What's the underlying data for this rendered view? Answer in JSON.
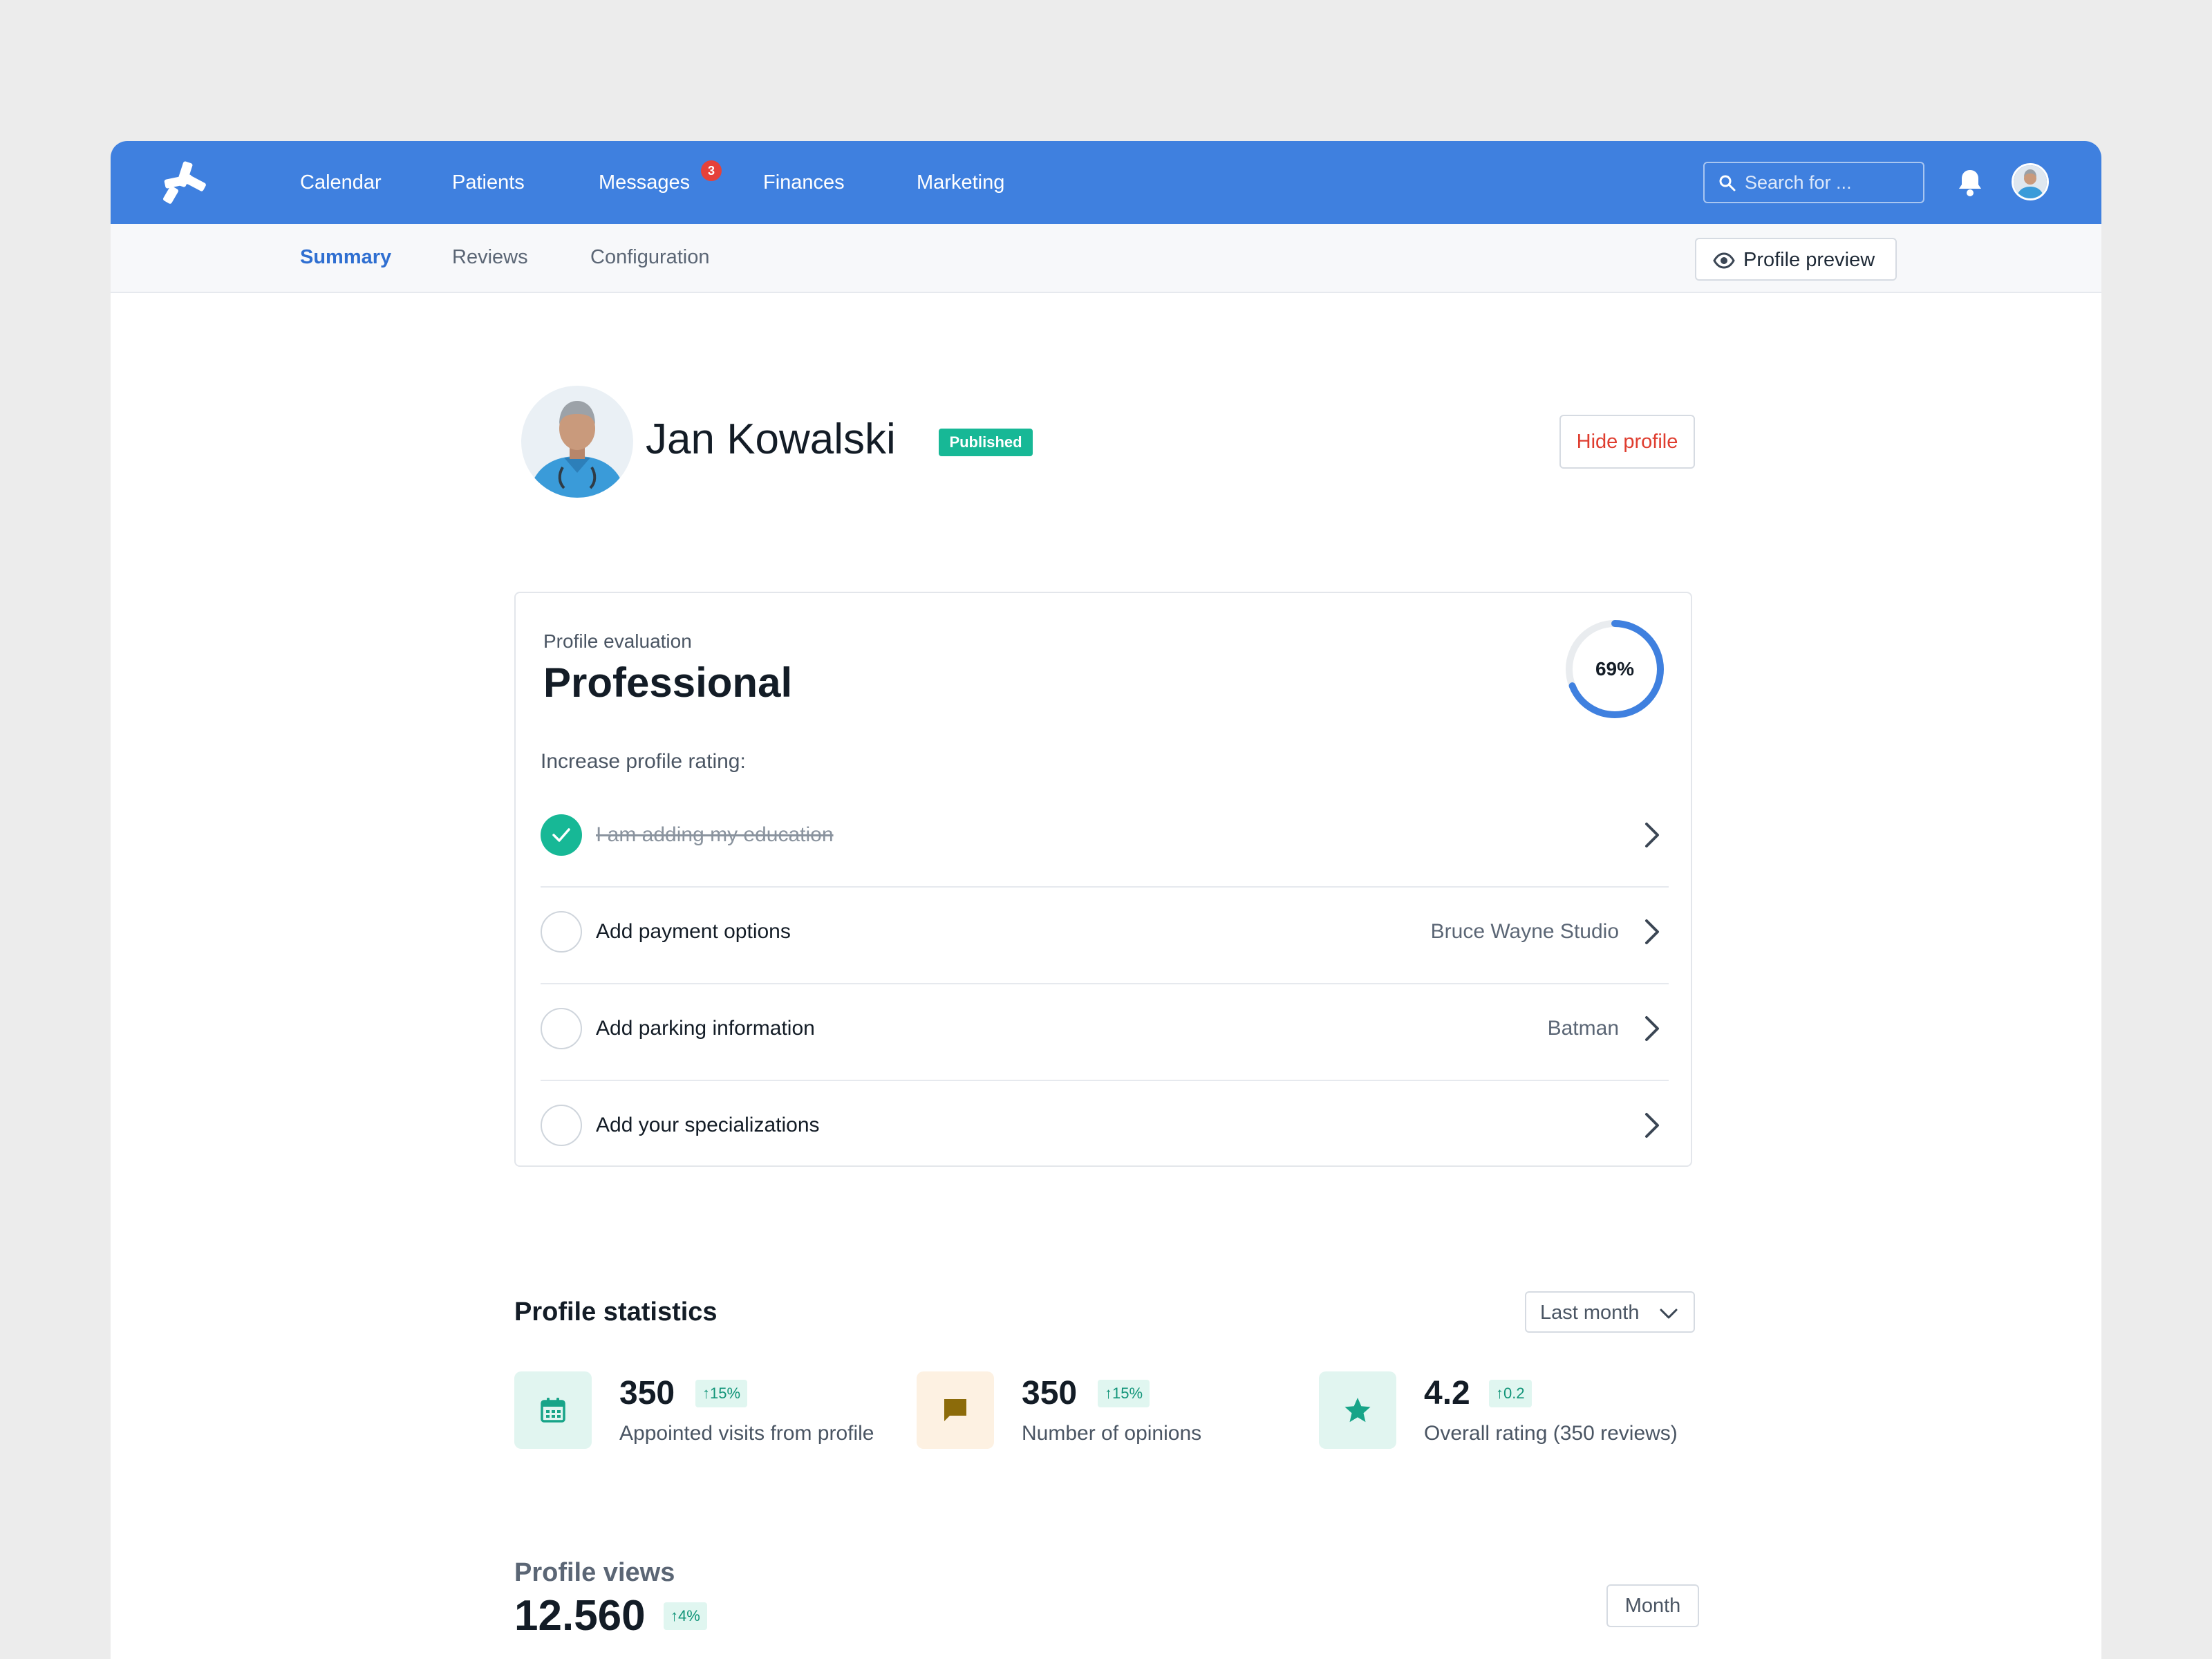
{
  "nav": {
    "items": [
      {
        "label": "Calendar"
      },
      {
        "label": "Patients"
      },
      {
        "label": "Messages",
        "badge": "3"
      },
      {
        "label": "Finances"
      },
      {
        "label": "Marketing"
      }
    ],
    "search_placeholder": "Search for ...",
    "brand_color": "#3f80df"
  },
  "subnav": {
    "tabs": [
      {
        "label": "Summary",
        "active": true
      },
      {
        "label": "Reviews"
      },
      {
        "label": "Configuration"
      }
    ],
    "preview_button": "Profile preview"
  },
  "profile": {
    "name": "Jan Kowalski",
    "status": "Published",
    "hide_button": "Hide profile"
  },
  "evaluation": {
    "label": "Profile evaluation",
    "title": "Professional",
    "percent": 69,
    "percent_label": "69%",
    "increase_label": "Increase profile rating:",
    "tasks": [
      {
        "label": "I am adding my education",
        "done": true,
        "value": ""
      },
      {
        "label": "Add payment options",
        "done": false,
        "value": "Bruce Wayne Studio"
      },
      {
        "label": "Add parking information",
        "done": false,
        "value": "Batman"
      },
      {
        "label": "Add your specializations",
        "done": false,
        "value": ""
      }
    ]
  },
  "statistics": {
    "title": "Profile statistics",
    "period": "Last month",
    "items": [
      {
        "value": "350",
        "change": "↑15%",
        "label": "Appointed visits from profile",
        "icon": "calendar-icon"
      },
      {
        "value": "350",
        "change": "↑15%",
        "label": "Number of opinions",
        "icon": "comment-icon"
      },
      {
        "value": "4.2",
        "change": "↑0.2",
        "label": "Overall rating (350 reviews)",
        "icon": "star-icon"
      }
    ]
  },
  "views": {
    "title": "Profile views",
    "value": "12.560",
    "change": "↑4%",
    "period": "Month"
  }
}
